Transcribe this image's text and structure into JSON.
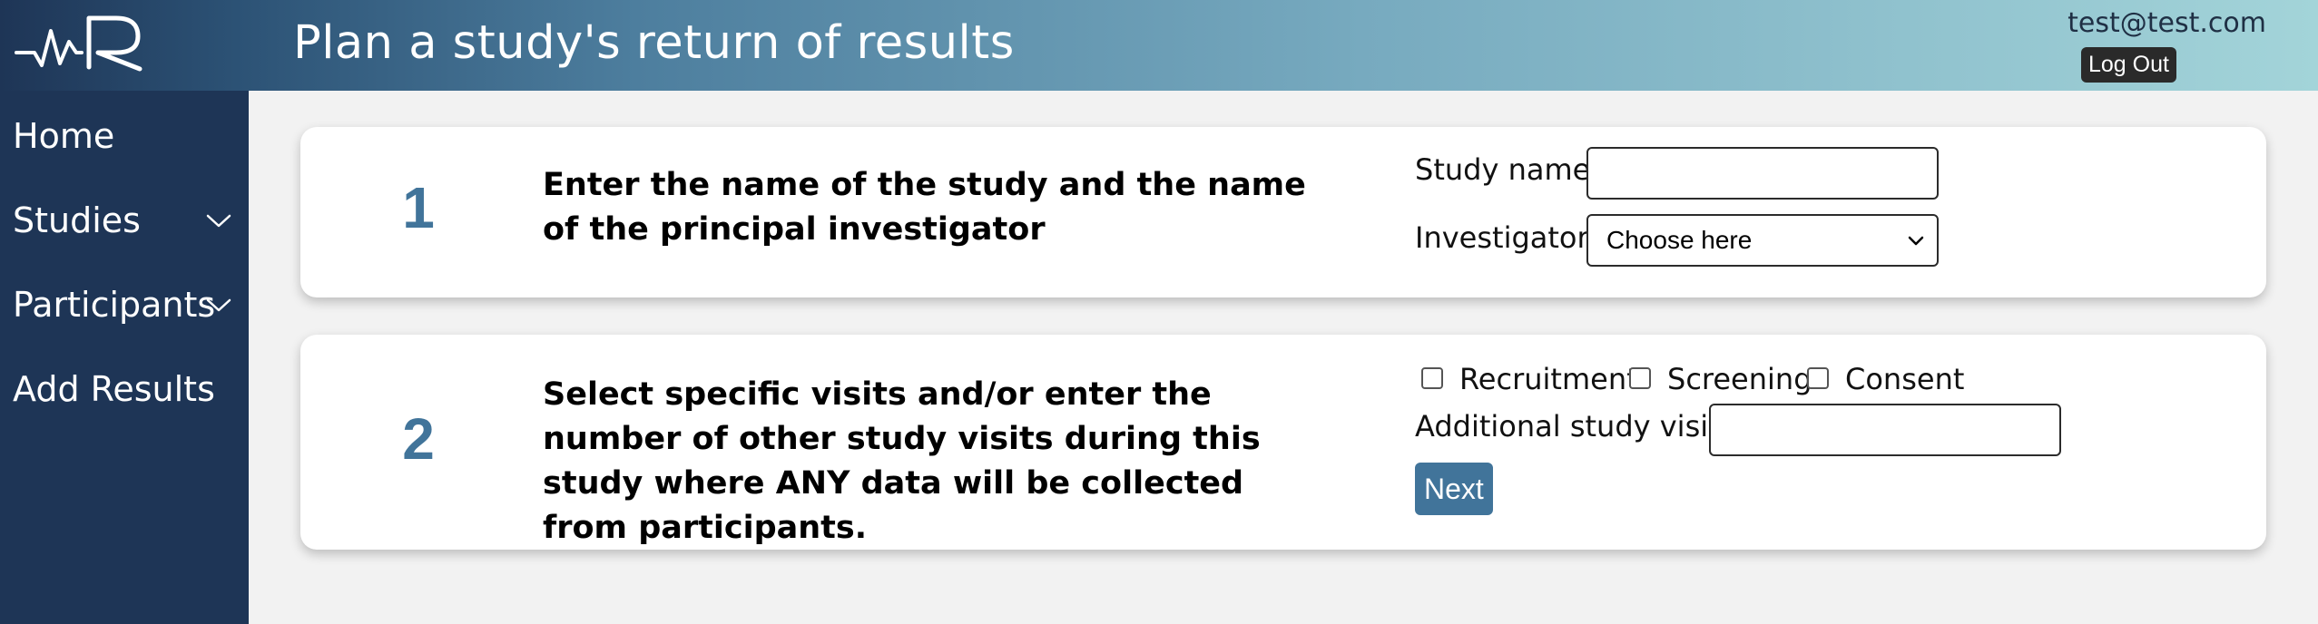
{
  "header": {
    "title": "Plan a study's return of results",
    "user_email": "test@test.com",
    "logout_label": "Log Out",
    "logo_icon": "wave-r-logo",
    "gradient_colors": [
      "#1e3556",
      "#4d7e9e",
      "#a3d4d9"
    ]
  },
  "sidebar": {
    "background": "#1e3556",
    "items": [
      {
        "label": "Home",
        "has_submenu": false
      },
      {
        "label": "Studies",
        "has_submenu": true
      },
      {
        "label": "Participants",
        "has_submenu": true
      },
      {
        "label": "Add Results",
        "has_submenu": false
      }
    ]
  },
  "steps": [
    {
      "number": "1",
      "instruction": "Enter the name of the study and the name of the principal investigator",
      "study_name_label": "Study name:",
      "study_name_value": "",
      "investigator_label": "Investigator:",
      "investigator_selected": "Choose here"
    },
    {
      "number": "2",
      "instruction": "Select specific visits and/or enter the number of other study visits during this study where ANY data will be collected from participants.",
      "checkboxes": [
        {
          "label": "Recruitment",
          "checked": false
        },
        {
          "label": "Screening",
          "checked": false
        },
        {
          "label": "Consent",
          "checked": false
        }
      ],
      "additional_visits_label": "Additional study visits",
      "additional_visits_value": "",
      "next_label": "Next"
    }
  ],
  "colors": {
    "accent": "#41749a",
    "page_bg": "#f2f2f2"
  }
}
